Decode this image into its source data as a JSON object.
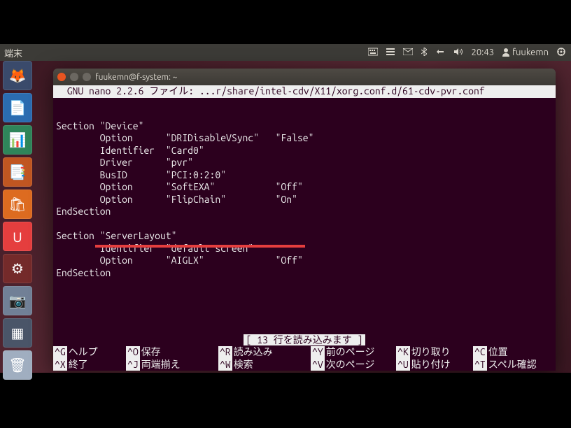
{
  "menubar": {
    "app_label": "端末",
    "time": "20:43",
    "user": "fuukemn"
  },
  "launcher": {
    "items": [
      {
        "name": "firefox",
        "glyph": "🦊"
      },
      {
        "name": "writer",
        "glyph": "📄"
      },
      {
        "name": "calc",
        "glyph": "📊"
      },
      {
        "name": "impress",
        "glyph": "📑"
      },
      {
        "name": "software-center",
        "glyph": "🛍"
      },
      {
        "name": "ubuntu-one",
        "glyph": "U"
      },
      {
        "name": "settings",
        "glyph": "⚙"
      },
      {
        "name": "screenshot",
        "glyph": "📷"
      },
      {
        "name": "workspace",
        "glyph": "▦"
      },
      {
        "name": "trash",
        "glyph": "🗑"
      }
    ]
  },
  "terminal": {
    "title": "fuukemn@f-system: ~",
    "nano_header": "  GNU nano 2.2.6 ファイル: ...r/share/intel-cdv/X11/xorg.conf.d/61-cdv-pvr.conf",
    "content_lines": [
      "Section \"Device\"",
      "        Option      \"DRIDisableVSync\"   \"False\"",
      "        Identifier  \"Card0\"",
      "        Driver      \"pvr\"",
      "        BusID       \"PCI:0:2:0\"",
      "        Option      \"SoftEXA\"           \"Off\"",
      "        Option      \"FlipChain\"         \"On\"",
      "EndSection",
      "",
      "Section \"ServerLayout\"",
      "        Identifier  \"default screen\"",
      "        Option      \"AIGLX\"             \"Off\"",
      "EndSection"
    ],
    "status": "[ 13 行を読み込みます ]",
    "shortcuts_row1": [
      {
        "key": "^G",
        "label": "ヘルプ"
      },
      {
        "key": "^O",
        "label": "保存"
      },
      {
        "key": "^R",
        "label": "読み込み"
      },
      {
        "key": "^Y",
        "label": "前のページ"
      },
      {
        "key": "^K",
        "label": "切り取り"
      },
      {
        "key": "^C",
        "label": "位置"
      }
    ],
    "shortcuts_row2": [
      {
        "key": "^X",
        "label": "終了"
      },
      {
        "key": "^J",
        "label": "両端揃え"
      },
      {
        "key": "^W",
        "label": "検索"
      },
      {
        "key": "^V",
        "label": "次のページ"
      },
      {
        "key": "^U",
        "label": "貼り付け"
      },
      {
        "key": "^T",
        "label": "スペル確認"
      }
    ]
  }
}
